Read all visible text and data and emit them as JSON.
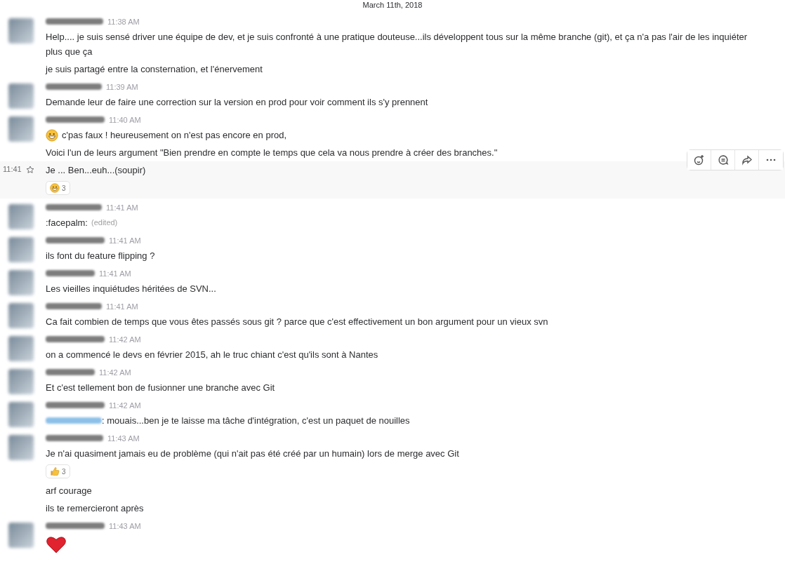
{
  "day_divider": {
    "label": "March 11th, 2018"
  },
  "messages": [
    {
      "kind": "header",
      "time": "11:38 AM",
      "text": "Help.... je suis sensé driver une équipe de dev, et je suis confronté à une pratique douteuse...ils développent tous sur la même branche (git), et ça n'a pas l'air de les inquiéter plus que ça"
    },
    {
      "kind": "continuation",
      "text": "je suis partagé entre la consternation, et l'énervement"
    },
    {
      "kind": "header",
      "time": "11:39 AM",
      "text": "Demande leur de faire une correction sur la version en prod pour voir comment ils s'y prennent"
    },
    {
      "kind": "header",
      "time": "11:40 AM",
      "emoji": {
        "kind": "grin"
      },
      "text": "c'pas faux ! heureusement on n'est pas encore en prod,"
    },
    {
      "kind": "continuation",
      "text": "Voici l'un de leurs argument \"Bien prendre en compte le temps que cela va nous prendre à créer des branches.\""
    },
    {
      "kind": "hovered",
      "time": "11:41",
      "text": "Je ... Ben...euh...(soupir)",
      "reactions": [
        {
          "kind": "grin",
          "count": "3"
        }
      ]
    },
    {
      "kind": "header",
      "time": "11:41 AM",
      "text": ":facepalm:",
      "edited": "(edited)"
    },
    {
      "kind": "header",
      "time": "11:41 AM",
      "text": "ils font du feature flipping ?"
    },
    {
      "kind": "header",
      "time": "11:41 AM",
      "text": "Les vieilles inquiétudes héritées de SVN..."
    },
    {
      "kind": "header",
      "time": "11:41 AM",
      "text": "Ca fait combien de temps que vous êtes passés sous git ? parce que c'est effectivement un bon argument pour un vieux svn"
    },
    {
      "kind": "header",
      "time": "11:42 AM",
      "text": "on a commencé le devs en février 2015, ah le truc chiant c'est qu'ils sont à Nantes"
    },
    {
      "kind": "header",
      "time": "11:42 AM",
      "text": "Et c'est tellement bon de fusionner une branche avec Git"
    },
    {
      "kind": "header",
      "time": "11:42 AM",
      "mention": true,
      "text": ": mouais...ben je te laisse ma tâche d'intégration, c'est un paquet de nouilles"
    },
    {
      "kind": "header",
      "time": "11:43 AM",
      "text": "Je n'ai quasiment jamais eu de problème (qui n'ait pas été créé par un humain) lors de merge avec Git",
      "reactions": [
        {
          "kind": "thumbs",
          "count": "3"
        }
      ]
    },
    {
      "kind": "continuation",
      "text": "arf courage"
    },
    {
      "kind": "continuation",
      "text": "ils te remercieront après"
    },
    {
      "kind": "header",
      "time": "11:43 AM",
      "big_emoji": {
        "kind": "heart"
      }
    }
  ],
  "hover_actions": [
    {
      "kind": "reaction"
    },
    {
      "kind": "thread"
    },
    {
      "kind": "share"
    },
    {
      "kind": "more"
    }
  ]
}
